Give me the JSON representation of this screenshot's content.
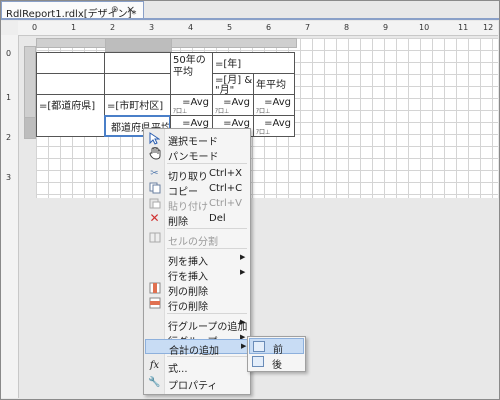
{
  "tab": {
    "title": "RdlReport1.rdlx[デザイン]*",
    "pin": "⊕",
    "close": "×"
  },
  "ruler": {
    "h": [
      "0",
      "1",
      "2",
      "3",
      "4",
      "5",
      "6",
      "7",
      "8",
      "9",
      "10",
      "11",
      "12"
    ],
    "v": [
      "0",
      "1",
      "2",
      "3"
    ]
  },
  "table": {
    "header_avg": "50年の平均",
    "year": "=[年]",
    "month": "=[月] & \"月\"",
    "year_avg": "年平均",
    "pref": "=[都道府県]",
    "city": "=[市町村区]",
    "avg": "=Avg",
    "avg_sub": "ｱ口⊥",
    "pref_avg": "都道府県平均"
  },
  "menu": {
    "select_mode": "選択モード",
    "pan_mode": "パンモード",
    "cut": "切り取り",
    "cut_sc": "Ctrl+X",
    "copy": "コピー",
    "copy_sc": "Ctrl+C",
    "paste": "貼り付け",
    "paste_sc": "Ctrl+V",
    "delete": "削除",
    "delete_sc": "Del",
    "split_cells": "セルの分割",
    "insert_column": "列を挿入",
    "insert_row": "行を挿入",
    "delete_column": "列の削除",
    "delete_row": "行の削除",
    "add_row_group": "行グループの追加",
    "row_group": "行グループ",
    "add_total": "合計の追加",
    "expression": "式...",
    "properties": "プロパティ"
  },
  "submenu": {
    "before": "前",
    "after": "後"
  },
  "colors": {
    "accent": "#4a7fc8",
    "highlight": "#c8dcf4",
    "delete_red": "#d03030"
  }
}
